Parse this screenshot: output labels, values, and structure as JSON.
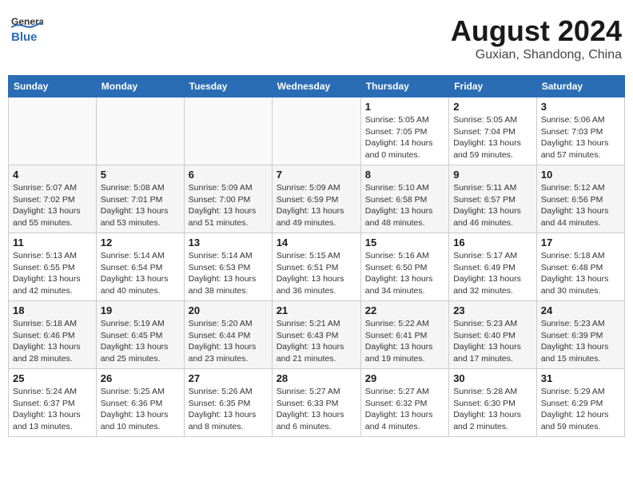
{
  "header": {
    "logo_general": "General",
    "logo_blue": "Blue",
    "month_title": "August 2024",
    "location": "Guxian, Shandong, China"
  },
  "weekdays": [
    "Sunday",
    "Monday",
    "Tuesday",
    "Wednesday",
    "Thursday",
    "Friday",
    "Saturday"
  ],
  "weeks": [
    {
      "days": [
        {
          "number": "",
          "info": ""
        },
        {
          "number": "",
          "info": ""
        },
        {
          "number": "",
          "info": ""
        },
        {
          "number": "",
          "info": ""
        },
        {
          "number": "1",
          "info": "Sunrise: 5:05 AM\nSunset: 7:05 PM\nDaylight: 14 hours\nand 0 minutes."
        },
        {
          "number": "2",
          "info": "Sunrise: 5:05 AM\nSunset: 7:04 PM\nDaylight: 13 hours\nand 59 minutes."
        },
        {
          "number": "3",
          "info": "Sunrise: 5:06 AM\nSunset: 7:03 PM\nDaylight: 13 hours\nand 57 minutes."
        }
      ]
    },
    {
      "days": [
        {
          "number": "4",
          "info": "Sunrise: 5:07 AM\nSunset: 7:02 PM\nDaylight: 13 hours\nand 55 minutes."
        },
        {
          "number": "5",
          "info": "Sunrise: 5:08 AM\nSunset: 7:01 PM\nDaylight: 13 hours\nand 53 minutes."
        },
        {
          "number": "6",
          "info": "Sunrise: 5:09 AM\nSunset: 7:00 PM\nDaylight: 13 hours\nand 51 minutes."
        },
        {
          "number": "7",
          "info": "Sunrise: 5:09 AM\nSunset: 6:59 PM\nDaylight: 13 hours\nand 49 minutes."
        },
        {
          "number": "8",
          "info": "Sunrise: 5:10 AM\nSunset: 6:58 PM\nDaylight: 13 hours\nand 48 minutes."
        },
        {
          "number": "9",
          "info": "Sunrise: 5:11 AM\nSunset: 6:57 PM\nDaylight: 13 hours\nand 46 minutes."
        },
        {
          "number": "10",
          "info": "Sunrise: 5:12 AM\nSunset: 6:56 PM\nDaylight: 13 hours\nand 44 minutes."
        }
      ]
    },
    {
      "days": [
        {
          "number": "11",
          "info": "Sunrise: 5:13 AM\nSunset: 6:55 PM\nDaylight: 13 hours\nand 42 minutes."
        },
        {
          "number": "12",
          "info": "Sunrise: 5:14 AM\nSunset: 6:54 PM\nDaylight: 13 hours\nand 40 minutes."
        },
        {
          "number": "13",
          "info": "Sunrise: 5:14 AM\nSunset: 6:53 PM\nDaylight: 13 hours\nand 38 minutes."
        },
        {
          "number": "14",
          "info": "Sunrise: 5:15 AM\nSunset: 6:51 PM\nDaylight: 13 hours\nand 36 minutes."
        },
        {
          "number": "15",
          "info": "Sunrise: 5:16 AM\nSunset: 6:50 PM\nDaylight: 13 hours\nand 34 minutes."
        },
        {
          "number": "16",
          "info": "Sunrise: 5:17 AM\nSunset: 6:49 PM\nDaylight: 13 hours\nand 32 minutes."
        },
        {
          "number": "17",
          "info": "Sunrise: 5:18 AM\nSunset: 6:48 PM\nDaylight: 13 hours\nand 30 minutes."
        }
      ]
    },
    {
      "days": [
        {
          "number": "18",
          "info": "Sunrise: 5:18 AM\nSunset: 6:46 PM\nDaylight: 13 hours\nand 28 minutes."
        },
        {
          "number": "19",
          "info": "Sunrise: 5:19 AM\nSunset: 6:45 PM\nDaylight: 13 hours\nand 25 minutes."
        },
        {
          "number": "20",
          "info": "Sunrise: 5:20 AM\nSunset: 6:44 PM\nDaylight: 13 hours\nand 23 minutes."
        },
        {
          "number": "21",
          "info": "Sunrise: 5:21 AM\nSunset: 6:43 PM\nDaylight: 13 hours\nand 21 minutes."
        },
        {
          "number": "22",
          "info": "Sunrise: 5:22 AM\nSunset: 6:41 PM\nDaylight: 13 hours\nand 19 minutes."
        },
        {
          "number": "23",
          "info": "Sunrise: 5:23 AM\nSunset: 6:40 PM\nDaylight: 13 hours\nand 17 minutes."
        },
        {
          "number": "24",
          "info": "Sunrise: 5:23 AM\nSunset: 6:39 PM\nDaylight: 13 hours\nand 15 minutes."
        }
      ]
    },
    {
      "days": [
        {
          "number": "25",
          "info": "Sunrise: 5:24 AM\nSunset: 6:37 PM\nDaylight: 13 hours\nand 13 minutes."
        },
        {
          "number": "26",
          "info": "Sunrise: 5:25 AM\nSunset: 6:36 PM\nDaylight: 13 hours\nand 10 minutes."
        },
        {
          "number": "27",
          "info": "Sunrise: 5:26 AM\nSunset: 6:35 PM\nDaylight: 13 hours\nand 8 minutes."
        },
        {
          "number": "28",
          "info": "Sunrise: 5:27 AM\nSunset: 6:33 PM\nDaylight: 13 hours\nand 6 minutes."
        },
        {
          "number": "29",
          "info": "Sunrise: 5:27 AM\nSunset: 6:32 PM\nDaylight: 13 hours\nand 4 minutes."
        },
        {
          "number": "30",
          "info": "Sunrise: 5:28 AM\nSunset: 6:30 PM\nDaylight: 13 hours\nand 2 minutes."
        },
        {
          "number": "31",
          "info": "Sunrise: 5:29 AM\nSunset: 6:29 PM\nDaylight: 12 hours\nand 59 minutes."
        }
      ]
    }
  ]
}
